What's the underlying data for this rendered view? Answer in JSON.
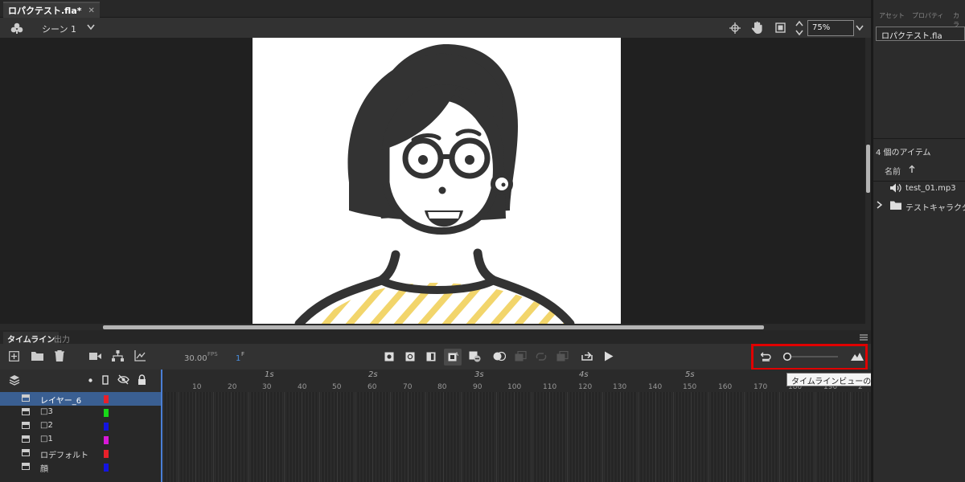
{
  "document": {
    "tab_title": "ロパクテスト.fla*"
  },
  "scene": {
    "label": "シーン 1",
    "zoom": "75%"
  },
  "timeline": {
    "tabs": [
      "タイムライン",
      "出力"
    ],
    "fps_value": "30.00",
    "fps_unit": "FPS",
    "current_frame": "1",
    "current_frame_unit": "F",
    "seconds": [
      "1s",
      "2s",
      "3s",
      "4s",
      "5s"
    ],
    "frame_numbers": [
      "10",
      "20",
      "30",
      "40",
      "50",
      "60",
      "70",
      "80",
      "90",
      "100",
      "110",
      "120",
      "130",
      "140",
      "150",
      "160",
      "170",
      "180",
      "190",
      "2"
    ],
    "layers": [
      {
        "name": "レイヤー_6",
        "color": "#e8202a",
        "selected": true
      },
      {
        "name": "□3",
        "color": "#18d818",
        "selected": false
      },
      {
        "name": "□2",
        "color": "#1414e0",
        "selected": false
      },
      {
        "name": "□1",
        "color": "#d818d8",
        "selected": false
      },
      {
        "name": "ロデフォルト",
        "color": "#e8202a",
        "selected": false
      },
      {
        "name": "顔",
        "color": "#1414e0",
        "selected": false
      }
    ],
    "tooltip": "タイムラインビューのサイズを変更"
  },
  "assets": {
    "tabs": [
      "アセット",
      "プロパティ",
      "カラ"
    ],
    "file": "ロパクテスト.fla",
    "item_count": "4 個のアイテム",
    "name_header": "名前",
    "items": [
      {
        "name": "test_01.mp3",
        "icon": "speaker-icon"
      },
      {
        "name": "テストキャラクター",
        "icon": "folder-icon"
      }
    ]
  },
  "colors": {
    "accent": "#4a90e2",
    "highlight": "#e00000",
    "illustration_dark": "#333333",
    "stripe": "#f2d56b"
  }
}
